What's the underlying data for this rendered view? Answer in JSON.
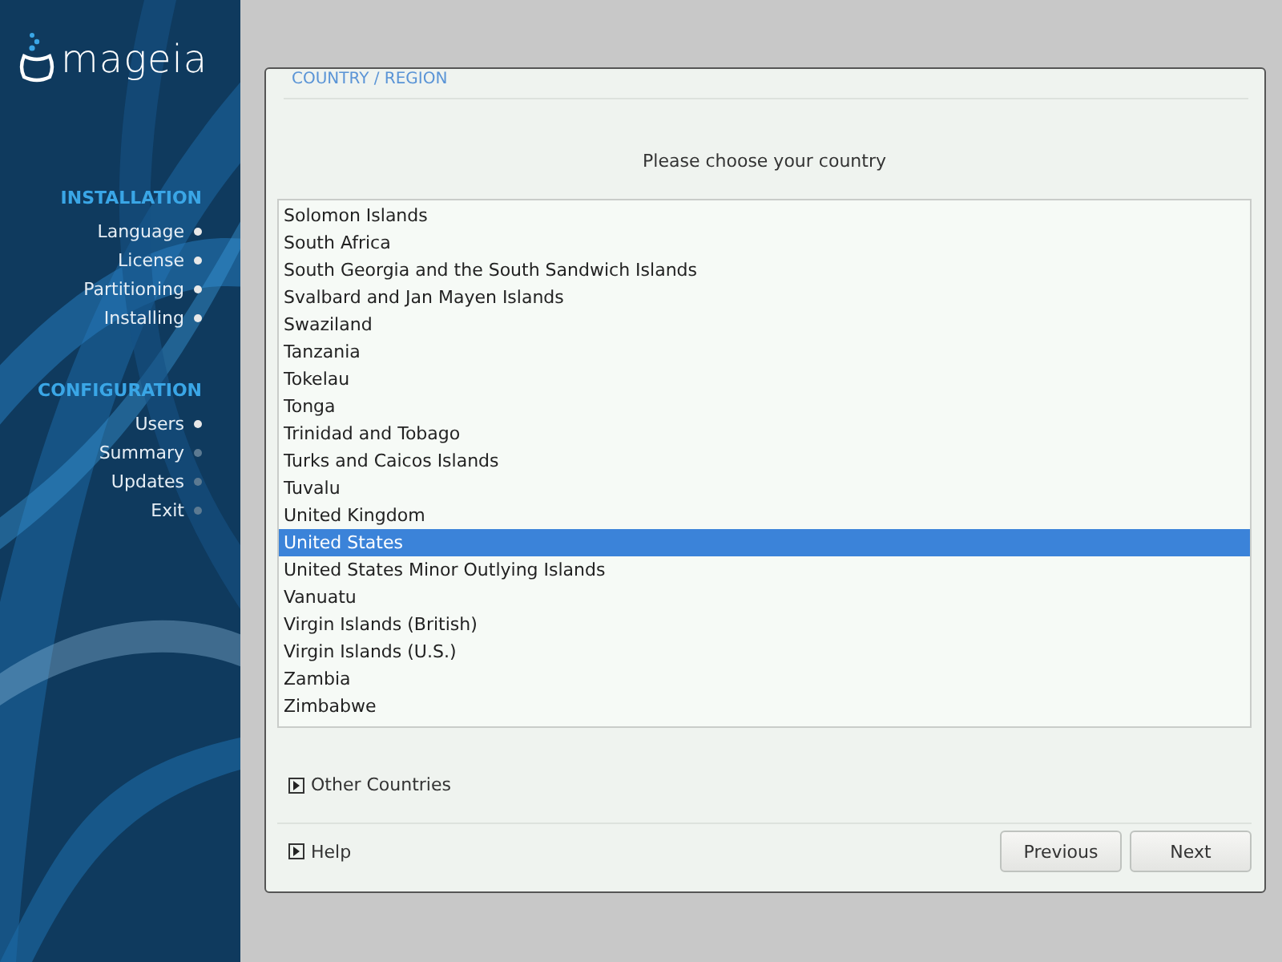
{
  "logo": "mageia",
  "sidebar": {
    "sections": [
      {
        "title": "INSTALLATION",
        "steps": [
          {
            "label": "Language",
            "done": true
          },
          {
            "label": "License",
            "done": true
          },
          {
            "label": "Partitioning",
            "done": true
          },
          {
            "label": "Installing",
            "done": true
          }
        ]
      },
      {
        "title": "CONFIGURATION",
        "steps": [
          {
            "label": "Users",
            "done": true
          },
          {
            "label": "Summary",
            "done": false
          },
          {
            "label": "Updates",
            "done": false
          },
          {
            "label": "Exit",
            "done": false
          }
        ]
      }
    ]
  },
  "panel": {
    "title": "COUNTRY / REGION",
    "prompt": "Please choose your country",
    "countries": [
      {
        "label": "Solomon Islands",
        "selected": false
      },
      {
        "label": "South Africa",
        "selected": false
      },
      {
        "label": "South Georgia and the South Sandwich Islands",
        "selected": false
      },
      {
        "label": "Svalbard and Jan Mayen Islands",
        "selected": false
      },
      {
        "label": "Swaziland",
        "selected": false
      },
      {
        "label": "Tanzania",
        "selected": false
      },
      {
        "label": "Tokelau",
        "selected": false
      },
      {
        "label": "Tonga",
        "selected": false
      },
      {
        "label": "Trinidad and Tobago",
        "selected": false
      },
      {
        "label": "Turks and Caicos Islands",
        "selected": false
      },
      {
        "label": "Tuvalu",
        "selected": false
      },
      {
        "label": "United Kingdom",
        "selected": false
      },
      {
        "label": "United States",
        "selected": true
      },
      {
        "label": "United States Minor Outlying Islands",
        "selected": false
      },
      {
        "label": "Vanuatu",
        "selected": false
      },
      {
        "label": "Virgin Islands (British)",
        "selected": false
      },
      {
        "label": "Virgin Islands (U.S.)",
        "selected": false
      },
      {
        "label": "Zambia",
        "selected": false
      },
      {
        "label": "Zimbabwe",
        "selected": false
      }
    ],
    "expander": {
      "label": "Other Countries",
      "expanded": false
    },
    "help": {
      "label": "Help",
      "expanded": false
    },
    "buttons": [
      "Previous",
      "Next"
    ]
  }
}
